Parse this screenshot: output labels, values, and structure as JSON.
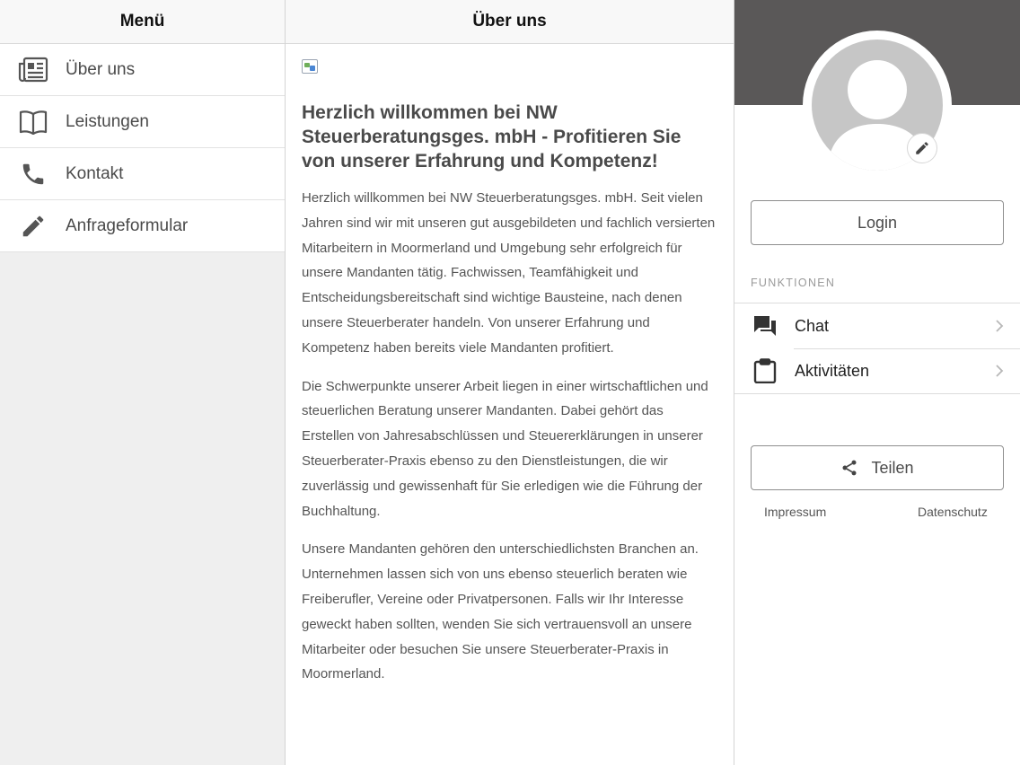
{
  "menu": {
    "title": "Menü",
    "items": [
      {
        "label": "Über uns",
        "icon": "newspaper-icon"
      },
      {
        "label": "Leistungen",
        "icon": "book-icon"
      },
      {
        "label": "Kontakt",
        "icon": "phone-icon"
      },
      {
        "label": "Anfrageformular",
        "icon": "pencil-icon"
      }
    ]
  },
  "content": {
    "title": "Über uns",
    "heading": "Herzlich willkommen bei NW Steuerberatungsges. mbH - Profitieren Sie von unserer Erfahrung und Kompetenz!",
    "paragraphs": [
      "Herzlich willkommen bei NW Steuerberatungsges. mbH. Seit vielen Jahren sind wir mit unseren gut ausgebildeten und fachlich versierten Mitarbeitern in Moormerland und Umgebung sehr erfolgreich für unsere Mandanten tätig. Fachwissen, Teamfähigkeit und Entscheidungsbereitschaft sind wichtige Bausteine, nach denen unsere Steuerberater handeln. Von unserer Erfahrung und Kompetenz haben bereits viele Mandanten profitiert.",
      "Die Schwerpunkte unserer Arbeit liegen in einer wirtschaftlichen und steuerlichen Beratung unserer Mandanten. Dabei gehört das Erstellen von Jahresabschlüssen und Steuererklärungen in unserer Steuerberater-Praxis ebenso zu den Dienstleistungen, die wir zuverlässig und gewissenhaft für Sie erledigen wie die Führung der Buchhaltung.",
      "Unsere Mandanten gehören den unterschiedlichsten Branchen an. Unternehmen lassen sich von uns ebenso steuerlich beraten wie Freiberufler, Vereine oder Privatpersonen. Falls wir Ihr Interesse geweckt haben sollten, wenden Sie sich vertrauensvoll an unsere Mitarbeiter oder besuchen Sie unsere Steuerberater-Praxis in Moormerland."
    ]
  },
  "sidebar": {
    "login_label": "Login",
    "section_label": "FUNKTIONEN",
    "functions": [
      {
        "label": "Chat",
        "icon": "chat-icon"
      },
      {
        "label": "Aktivitäten",
        "icon": "clipboard-icon"
      }
    ],
    "share_label": "Teilen",
    "footer": {
      "impressum": "Impressum",
      "datenschutz": "Datenschutz"
    }
  },
  "colors": {
    "cover": "#5a5858",
    "menu_background": "#efefef",
    "avatar": "#c6c6c6"
  }
}
